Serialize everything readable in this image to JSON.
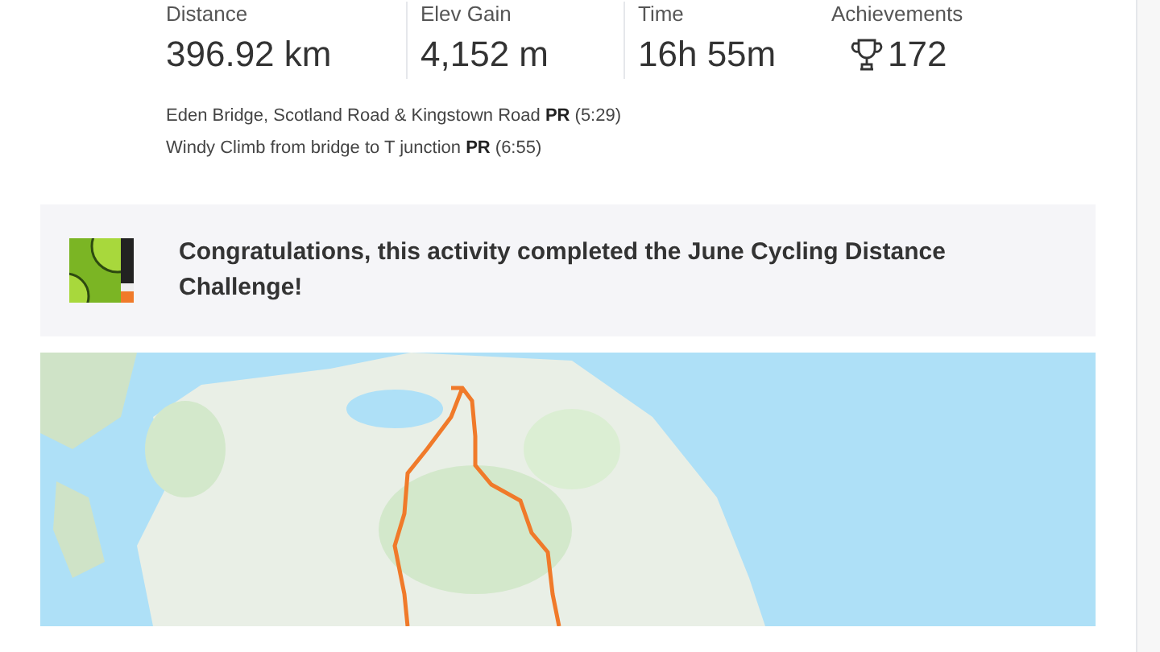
{
  "stats": [
    {
      "kind": "plain",
      "label": "Distance",
      "value": "396.92 km"
    },
    {
      "kind": "plain",
      "label": "Elev Gain",
      "value": "4,152 m"
    },
    {
      "kind": "plain",
      "label": "Time",
      "value": "16h 55m"
    },
    {
      "kind": "trophy",
      "label": "Achievements",
      "value": "172"
    }
  ],
  "segments": [
    {
      "name": "Eden Bridge, Scotland Road & Kingstown Road",
      "badge": "PR",
      "time": "(5:29)"
    },
    {
      "name": "Windy Climb from bridge to T junction",
      "badge": "PR",
      "time": "(6:55)"
    }
  ],
  "challenge": {
    "message": "Congratulations, this activity completed the June Cycling Distance Challenge!"
  }
}
